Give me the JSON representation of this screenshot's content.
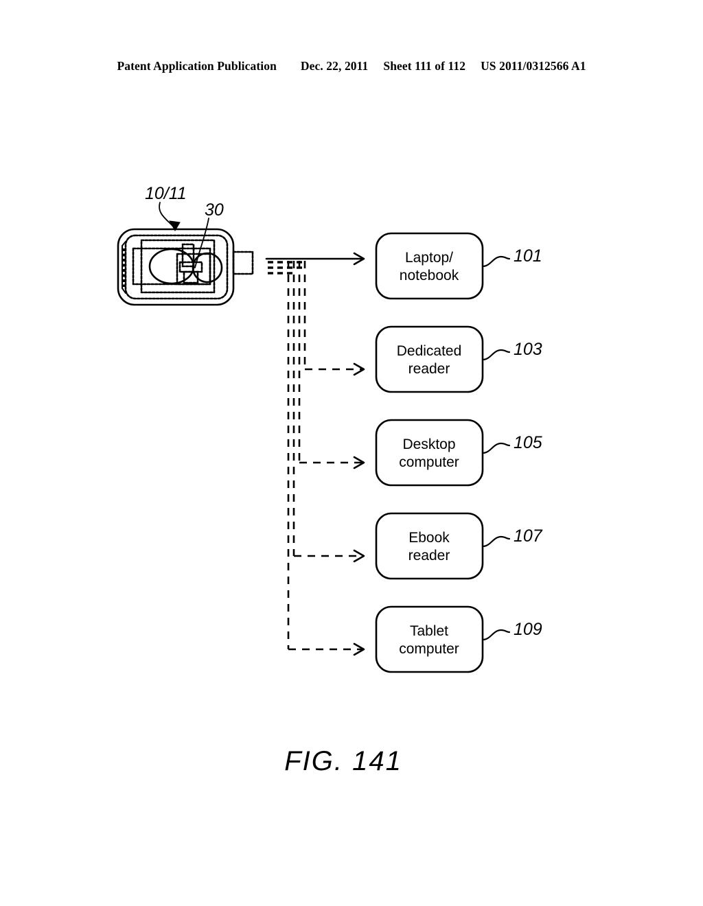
{
  "header": {
    "publication": "Patent Application Publication",
    "date": "Dec. 22, 2011",
    "sheet": "Sheet 111 of 112",
    "patent_number": "US 2011/0312566 A1"
  },
  "figure": {
    "caption": "FIG. 141",
    "device": {
      "ref_top": "10/11",
      "ref_inner": "30",
      "name": "portable-device-with-internal-module"
    },
    "signal": {
      "name": "wireless-signal-indicator",
      "description": "radiating dashes"
    },
    "targets": [
      {
        "id": "laptop-notebook",
        "line1": "Laptop/",
        "line2": "notebook",
        "ref": "101",
        "connector": "solid"
      },
      {
        "id": "dedicated-reader",
        "line1": "Dedicated",
        "line2": "reader",
        "ref": "103",
        "connector": "dashed"
      },
      {
        "id": "desktop-computer",
        "line1": "Desktop",
        "line2": "computer",
        "ref": "105",
        "connector": "dashed"
      },
      {
        "id": "ebook-reader",
        "line1": "Ebook",
        "line2": "reader",
        "ref": "107",
        "connector": "dashed"
      },
      {
        "id": "tablet-computer",
        "line1": "Tablet",
        "line2": "computer",
        "ref": "109",
        "connector": "dashed"
      }
    ]
  },
  "colors": {
    "ink": "#000000",
    "page": "#ffffff"
  }
}
